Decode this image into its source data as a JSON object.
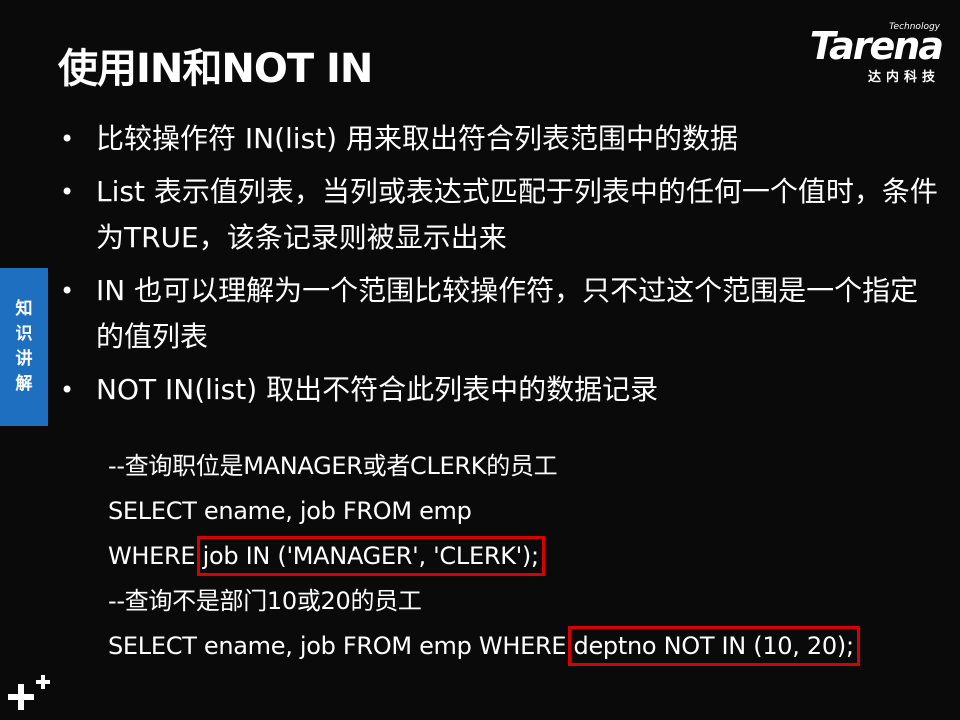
{
  "slide": {
    "title": "使用IN和NOT IN",
    "logo": {
      "technology": "Technology",
      "wordmark": "Tarena",
      "subtitle": "达内科技"
    },
    "side_tab": [
      "知",
      "识",
      "讲",
      "解"
    ],
    "bullets": [
      "比较操作符 IN(list) 用来取出符合列表范围中的数据",
      "List 表示值列表，当列或表达式匹配于列表中的任何一个值时，条件为TRUE，该条记录则被显示出来",
      "IN 也可以理解为一个范围比较操作符，只不过这个范围是一个指定的值列表",
      "NOT IN(list) 取出不符合此列表中的数据记录"
    ],
    "code": {
      "comment1": "--查询职位是MANAGER或者CLERK的员工",
      "line2": "SELECT ename, job FROM emp",
      "line3_prefix": "WHERE ",
      "line3_highlight": "job IN ('MANAGER', 'CLERK');",
      "comment2": "--查询不是部门10或20的员工",
      "line5_prefix": "SELECT ename, job FROM emp WHERE ",
      "line5_highlight": "deptno NOT IN (10, 20);"
    },
    "colors": {
      "background": "#0a0a0a",
      "side_tab": "#1f6fc0",
      "highlight_border": "#d50000",
      "text": "#ffffff"
    },
    "icons": {
      "bottom_left": "plus-icon"
    }
  }
}
